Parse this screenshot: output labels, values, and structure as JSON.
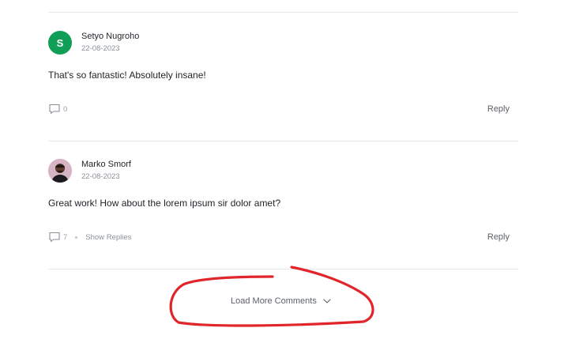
{
  "comments": [
    {
      "author": "Setyo Nugroho",
      "initial": "S",
      "date": "22-08-2023",
      "text": "That's so fantastic! Absolutely insane!",
      "reply_count": "0",
      "reply_label": "Reply",
      "avatar_color": "#119e56"
    },
    {
      "author": "Marko Smorf",
      "date": "22-08-2023",
      "text": "Great work! How about the lorem ipsum sir dolor amet?",
      "reply_count": "7",
      "show_replies_label": "Show Replies",
      "reply_label": "Reply",
      "avatar_color": "#d7b4c3"
    }
  ],
  "load_more": {
    "label": "Load More Comments",
    "icon": "chevron-down-icon"
  },
  "annotation": {
    "color": "#e0262b",
    "shape": "hand-drawn-circle"
  },
  "icons": {
    "comment": "comment-bubble-icon"
  }
}
